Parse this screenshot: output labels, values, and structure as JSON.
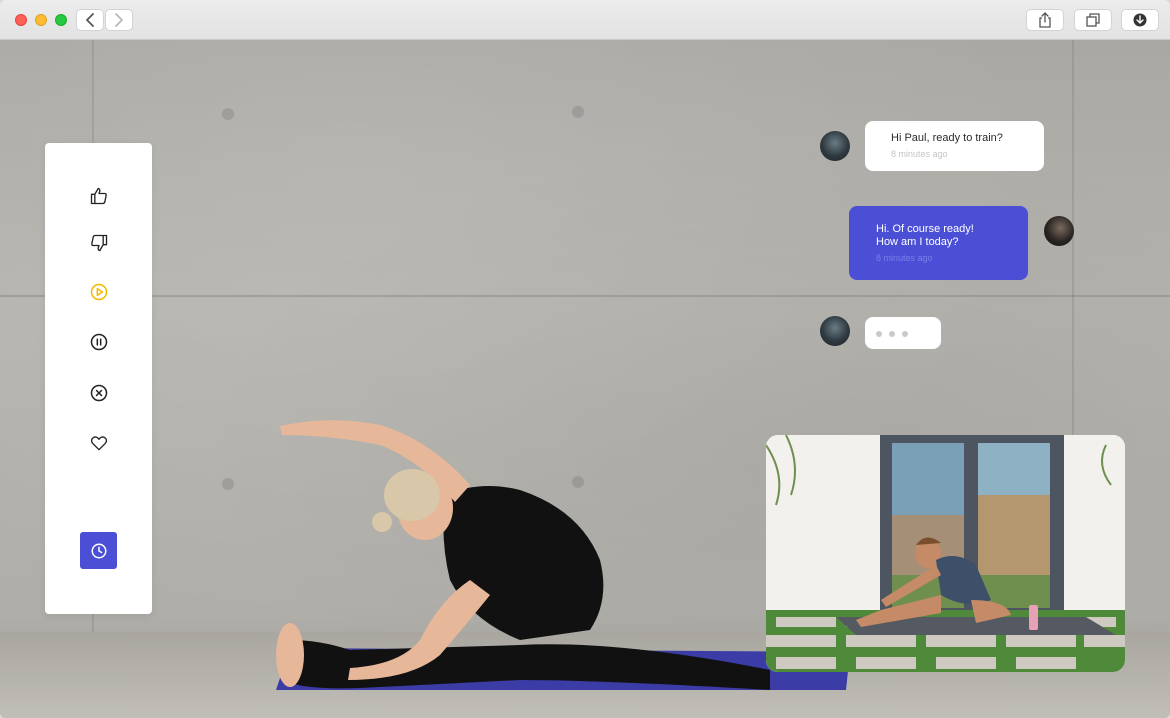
{
  "window": {
    "toolbar": {
      "back_icon": "chevron-left-icon",
      "forward_icon": "chevron-right-icon",
      "share_icon": "share-icon",
      "tabs_icon": "tabs-icon",
      "download_icon": "download-icon"
    }
  },
  "sidebar": {
    "items": [
      {
        "icon": "thumbs-up-icon",
        "active": false
      },
      {
        "icon": "thumbs-down-icon",
        "active": false
      },
      {
        "icon": "play-icon",
        "active": true,
        "color": "#f5b800"
      },
      {
        "icon": "pause-icon",
        "active": false
      },
      {
        "icon": "close-circle-icon",
        "active": false
      },
      {
        "icon": "heart-icon",
        "active": false
      }
    ],
    "clock_button": {
      "icon": "clock-icon",
      "color": "#4a4fd6"
    }
  },
  "chat": {
    "messages": [
      {
        "from": "coach",
        "line1": "Hi Paul, ready to train?",
        "time": "8 minutes ago"
      },
      {
        "from": "me",
        "line1": "Hi. Of course ready!",
        "line2": "How am I today?",
        "time": "8 minutes ago"
      }
    ],
    "typing": true
  },
  "colors": {
    "accent": "#4a4fd6",
    "active_icon": "#f5b800"
  }
}
